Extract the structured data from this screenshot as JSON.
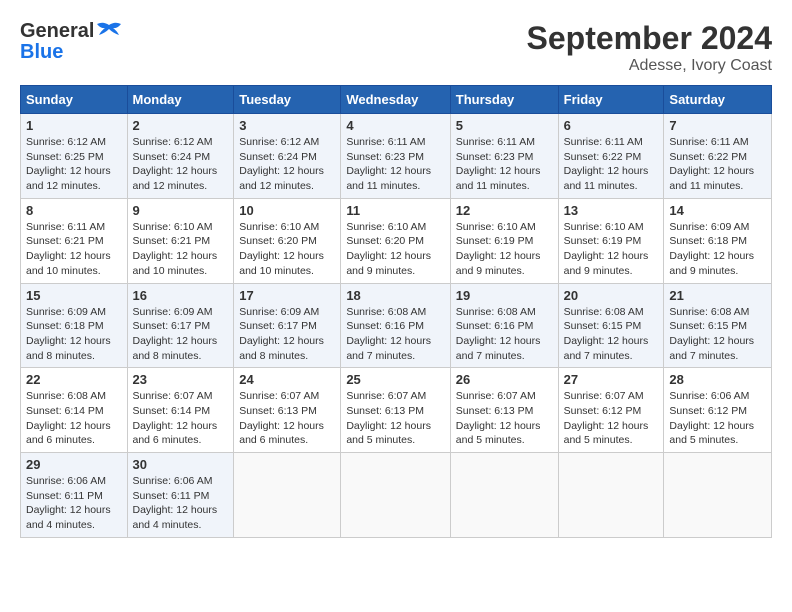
{
  "logo": {
    "line1": "General",
    "line2": "Blue"
  },
  "title": "September 2024",
  "subtitle": "Adesse, Ivory Coast",
  "days_of_week": [
    "Sunday",
    "Monday",
    "Tuesday",
    "Wednesday",
    "Thursday",
    "Friday",
    "Saturday"
  ],
  "weeks": [
    [
      {
        "day": "1",
        "sunrise": "Sunrise: 6:12 AM",
        "sunset": "Sunset: 6:25 PM",
        "daylight": "Daylight: 12 hours and 12 minutes."
      },
      {
        "day": "2",
        "sunrise": "Sunrise: 6:12 AM",
        "sunset": "Sunset: 6:24 PM",
        "daylight": "Daylight: 12 hours and 12 minutes."
      },
      {
        "day": "3",
        "sunrise": "Sunrise: 6:12 AM",
        "sunset": "Sunset: 6:24 PM",
        "daylight": "Daylight: 12 hours and 12 minutes."
      },
      {
        "day": "4",
        "sunrise": "Sunrise: 6:11 AM",
        "sunset": "Sunset: 6:23 PM",
        "daylight": "Daylight: 12 hours and 11 minutes."
      },
      {
        "day": "5",
        "sunrise": "Sunrise: 6:11 AM",
        "sunset": "Sunset: 6:23 PM",
        "daylight": "Daylight: 12 hours and 11 minutes."
      },
      {
        "day": "6",
        "sunrise": "Sunrise: 6:11 AM",
        "sunset": "Sunset: 6:22 PM",
        "daylight": "Daylight: 12 hours and 11 minutes."
      },
      {
        "day": "7",
        "sunrise": "Sunrise: 6:11 AM",
        "sunset": "Sunset: 6:22 PM",
        "daylight": "Daylight: 12 hours and 11 minutes."
      }
    ],
    [
      {
        "day": "8",
        "sunrise": "Sunrise: 6:11 AM",
        "sunset": "Sunset: 6:21 PM",
        "daylight": "Daylight: 12 hours and 10 minutes."
      },
      {
        "day": "9",
        "sunrise": "Sunrise: 6:10 AM",
        "sunset": "Sunset: 6:21 PM",
        "daylight": "Daylight: 12 hours and 10 minutes."
      },
      {
        "day": "10",
        "sunrise": "Sunrise: 6:10 AM",
        "sunset": "Sunset: 6:20 PM",
        "daylight": "Daylight: 12 hours and 10 minutes."
      },
      {
        "day": "11",
        "sunrise": "Sunrise: 6:10 AM",
        "sunset": "Sunset: 6:20 PM",
        "daylight": "Daylight: 12 hours and 9 minutes."
      },
      {
        "day": "12",
        "sunrise": "Sunrise: 6:10 AM",
        "sunset": "Sunset: 6:19 PM",
        "daylight": "Daylight: 12 hours and 9 minutes."
      },
      {
        "day": "13",
        "sunrise": "Sunrise: 6:10 AM",
        "sunset": "Sunset: 6:19 PM",
        "daylight": "Daylight: 12 hours and 9 minutes."
      },
      {
        "day": "14",
        "sunrise": "Sunrise: 6:09 AM",
        "sunset": "Sunset: 6:18 PM",
        "daylight": "Daylight: 12 hours and 9 minutes."
      }
    ],
    [
      {
        "day": "15",
        "sunrise": "Sunrise: 6:09 AM",
        "sunset": "Sunset: 6:18 PM",
        "daylight": "Daylight: 12 hours and 8 minutes."
      },
      {
        "day": "16",
        "sunrise": "Sunrise: 6:09 AM",
        "sunset": "Sunset: 6:17 PM",
        "daylight": "Daylight: 12 hours and 8 minutes."
      },
      {
        "day": "17",
        "sunrise": "Sunrise: 6:09 AM",
        "sunset": "Sunset: 6:17 PM",
        "daylight": "Daylight: 12 hours and 8 minutes."
      },
      {
        "day": "18",
        "sunrise": "Sunrise: 6:08 AM",
        "sunset": "Sunset: 6:16 PM",
        "daylight": "Daylight: 12 hours and 7 minutes."
      },
      {
        "day": "19",
        "sunrise": "Sunrise: 6:08 AM",
        "sunset": "Sunset: 6:16 PM",
        "daylight": "Daylight: 12 hours and 7 minutes."
      },
      {
        "day": "20",
        "sunrise": "Sunrise: 6:08 AM",
        "sunset": "Sunset: 6:15 PM",
        "daylight": "Daylight: 12 hours and 7 minutes."
      },
      {
        "day": "21",
        "sunrise": "Sunrise: 6:08 AM",
        "sunset": "Sunset: 6:15 PM",
        "daylight": "Daylight: 12 hours and 7 minutes."
      }
    ],
    [
      {
        "day": "22",
        "sunrise": "Sunrise: 6:08 AM",
        "sunset": "Sunset: 6:14 PM",
        "daylight": "Daylight: 12 hours and 6 minutes."
      },
      {
        "day": "23",
        "sunrise": "Sunrise: 6:07 AM",
        "sunset": "Sunset: 6:14 PM",
        "daylight": "Daylight: 12 hours and 6 minutes."
      },
      {
        "day": "24",
        "sunrise": "Sunrise: 6:07 AM",
        "sunset": "Sunset: 6:13 PM",
        "daylight": "Daylight: 12 hours and 6 minutes."
      },
      {
        "day": "25",
        "sunrise": "Sunrise: 6:07 AM",
        "sunset": "Sunset: 6:13 PM",
        "daylight": "Daylight: 12 hours and 5 minutes."
      },
      {
        "day": "26",
        "sunrise": "Sunrise: 6:07 AM",
        "sunset": "Sunset: 6:13 PM",
        "daylight": "Daylight: 12 hours and 5 minutes."
      },
      {
        "day": "27",
        "sunrise": "Sunrise: 6:07 AM",
        "sunset": "Sunset: 6:12 PM",
        "daylight": "Daylight: 12 hours and 5 minutes."
      },
      {
        "day": "28",
        "sunrise": "Sunrise: 6:06 AM",
        "sunset": "Sunset: 6:12 PM",
        "daylight": "Daylight: 12 hours and 5 minutes."
      }
    ],
    [
      {
        "day": "29",
        "sunrise": "Sunrise: 6:06 AM",
        "sunset": "Sunset: 6:11 PM",
        "daylight": "Daylight: 12 hours and 4 minutes."
      },
      {
        "day": "30",
        "sunrise": "Sunrise: 6:06 AM",
        "sunset": "Sunset: 6:11 PM",
        "daylight": "Daylight: 12 hours and 4 minutes."
      },
      null,
      null,
      null,
      null,
      null
    ]
  ]
}
